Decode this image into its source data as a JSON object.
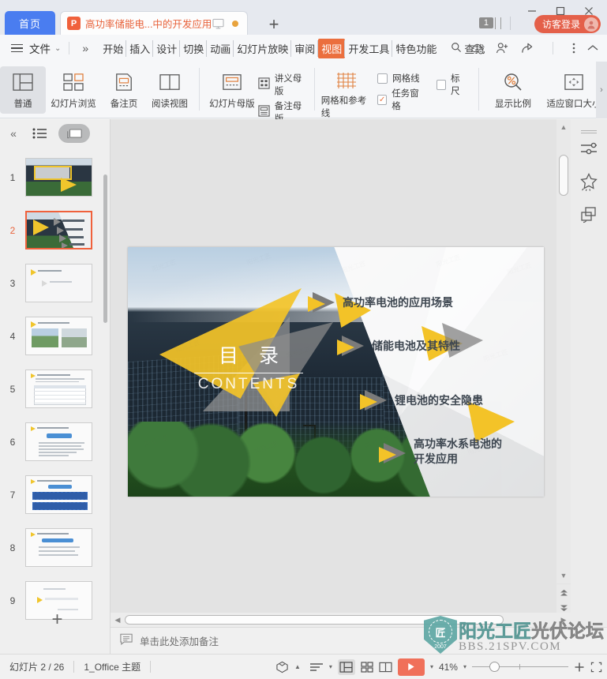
{
  "titlebar": {
    "home_tab": "首页",
    "doc_tab_label": "高功率储能电...中的开发应用",
    "doc_icon_letter": "P",
    "new_tab": "+",
    "count_badge": "1",
    "guest_login": "访客登录",
    "minimize": "—",
    "maximize": "□",
    "close": "✕"
  },
  "menubar": {
    "file": "文件",
    "chevron_more": "»",
    "items": [
      {
        "label": "开始",
        "active": false
      },
      {
        "label": "插入",
        "active": false
      },
      {
        "label": "设计",
        "active": false
      },
      {
        "label": "切换",
        "active": false
      },
      {
        "label": "动画",
        "active": false
      },
      {
        "label": "幻灯片放映",
        "active": false
      },
      {
        "label": "审阅",
        "active": false
      },
      {
        "label": "视图",
        "active": true
      },
      {
        "label": "开发工具",
        "active": false
      },
      {
        "label": "特色功能",
        "active": false
      }
    ],
    "find": "查找"
  },
  "ribbon": {
    "group1": [
      {
        "label": "普通",
        "icon": "normal-view-icon",
        "selected": true
      },
      {
        "label": "幻灯片浏览",
        "icon": "slide-sorter-icon",
        "selected": false
      },
      {
        "label": "备注页",
        "icon": "notes-page-icon",
        "selected": false
      },
      {
        "label": "阅读视图",
        "icon": "reading-view-icon",
        "selected": false
      }
    ],
    "group2": [
      {
        "label": "幻灯片母版",
        "icon": "slide-master-icon"
      }
    ],
    "group2b": [
      {
        "label": "讲义母版",
        "icon": "handout-master-icon"
      },
      {
        "label": "备注母版",
        "icon": "notes-master-icon"
      }
    ],
    "group3": [
      {
        "label": "网格和参考线",
        "icon": "grid-guides-icon"
      }
    ],
    "checks": [
      {
        "label": "网格线",
        "checked": false
      },
      {
        "label": "标尺",
        "checked": false
      },
      {
        "label": "任务窗格",
        "checked": true
      }
    ],
    "group4": [
      {
        "label": "显示比例",
        "icon": "zoom-percent-icon"
      },
      {
        "label": "适应窗口大小",
        "icon": "fit-window-icon"
      }
    ],
    "expander": "›"
  },
  "thumbpanel": {
    "collapse": "«",
    "outline_tab": "outline-icon",
    "slides_tab": "slides-icon",
    "slides": [
      {
        "number": "1",
        "active": false
      },
      {
        "number": "2",
        "active": true
      },
      {
        "number": "3",
        "active": false
      },
      {
        "number": "4",
        "active": false
      },
      {
        "number": "5",
        "active": false
      },
      {
        "number": "6",
        "active": false
      },
      {
        "number": "7",
        "active": false
      },
      {
        "number": "8",
        "active": false
      },
      {
        "number": "9",
        "active": false
      }
    ],
    "add_slide": "+"
  },
  "slide": {
    "toc_cn": "目 录",
    "toc_en": "CONTENTS",
    "items": [
      {
        "text": "高功率电池的应用场景"
      },
      {
        "text": "储能电池及其特性"
      },
      {
        "text": "锂电池的安全隐患"
      },
      {
        "text": "高功率水系电池的\n开发应用"
      }
    ]
  },
  "notes": {
    "placeholder": "单击此处添加备注",
    "icon": "notes-icon"
  },
  "rail": [
    {
      "icon": "sliders-icon"
    },
    {
      "icon": "magic-star-icon"
    },
    {
      "icon": "duplicate-icon"
    }
  ],
  "statusbar": {
    "slide_count": "幻灯片 2 / 26",
    "theme": "1_Office 主题",
    "zoom": "41%",
    "icons": [
      "shape-icon",
      "align-icon",
      "normal-view-icon",
      "sorter-view-icon",
      "reading-view-icon",
      "play-icon"
    ]
  },
  "watermark": {
    "shield_letter": "匠",
    "year": "2007",
    "name_part1": "阳光工匠",
    "name_part2": "光伏论坛",
    "url": "BBS.21SPV.COM"
  },
  "colors": {
    "accent_orange": "#eb6f3e",
    "tab_blue": "#4a7df0",
    "login_red": "#e4604a",
    "slide_yellow": "#f3c328",
    "slide_gray": "#7b7b7b",
    "watermark_teal": "#5fa8a5"
  }
}
